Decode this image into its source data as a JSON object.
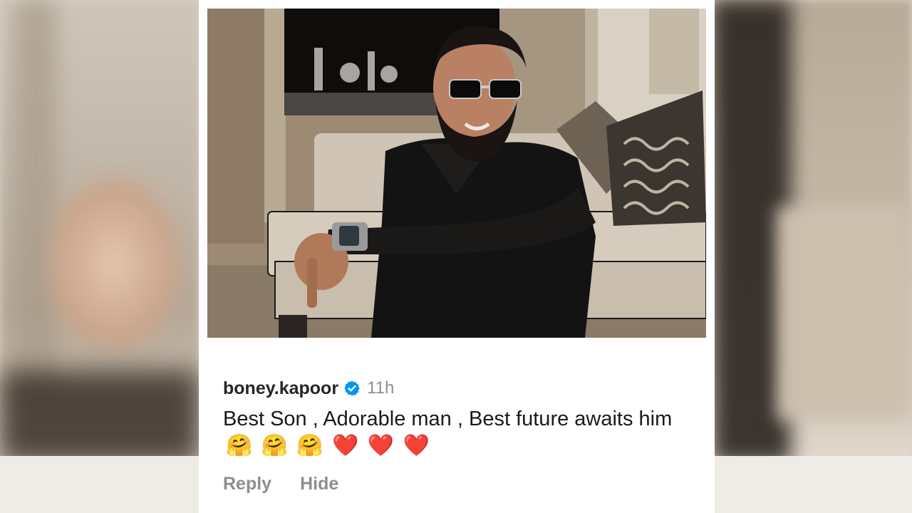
{
  "comment": {
    "username": "boney.kapoor",
    "verified_icon": "verified-badge-icon",
    "time": "11h",
    "text": "Best Son , Adorable man , Best future awaits him",
    "emojis": [
      "🤗",
      "🤗",
      "🤗",
      "❤️",
      "❤️",
      "❤️"
    ]
  },
  "actions": {
    "reply_label": "Reply",
    "hide_label": "Hide"
  },
  "colors": {
    "verified_blue": "#0095f6",
    "username": "#262626",
    "muted": "#8e8e8e",
    "card_bg": "#ffffff"
  }
}
